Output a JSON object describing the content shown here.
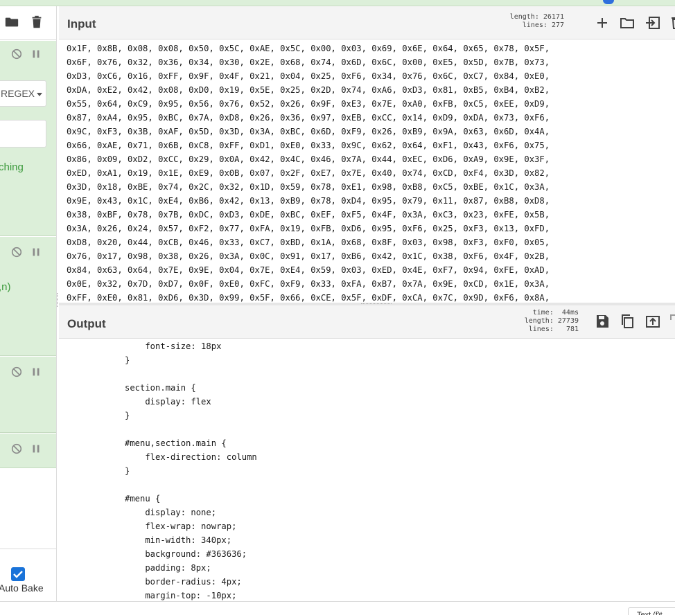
{
  "colors": {
    "operation_bg": "#dcefd9",
    "accent_blue": "#1a73d9",
    "regex_text_green": "#3c9a3c",
    "pane_header_bg": "#f4f4f4"
  },
  "recipe": {
    "toolbar_icons": [
      "folder-icon",
      "trash-icon"
    ],
    "operations": [
      {
        "controls": [
          "disable-icon",
          "pause-icon"
        ],
        "regex_button": "REGEX",
        "text": "ching"
      },
      {
        "controls": [
          "disable-icon",
          "pause-icon"
        ],
        "text": ",n)"
      },
      {
        "controls": [
          "disable-icon",
          "pause-icon"
        ]
      },
      {
        "controls": [
          "disable-icon",
          "pause-icon"
        ]
      }
    ],
    "auto_bake": {
      "label": "Auto Bake",
      "checked": true
    }
  },
  "input": {
    "title": "Input",
    "stats": {
      "length_label": "length:",
      "length": "26171",
      "lines_label": "lines:",
      "lines": "277"
    },
    "icons": [
      "add-tab-icon",
      "open-folder-icon",
      "import-icon",
      "delete-icon"
    ],
    "lines": [
      "0x1F, 0x8B, 0x08, 0x08, 0x50, 0x5C, 0xAE, 0x5C, 0x00, 0x03, 0x69, 0x6E, 0x64, 0x65, 0x78, 0x5F,",
      "0x6F, 0x76, 0x32, 0x36, 0x34, 0x30, 0x2E, 0x68, 0x74, 0x6D, 0x6C, 0x00, 0xE5, 0x5D, 0x7B, 0x73,",
      "0xD3, 0xC6, 0x16, 0xFF, 0x9F, 0x4F, 0x21, 0x04, 0x25, 0xF6, 0x34, 0x76, 0x6C, 0xC7, 0x84, 0xE0,",
      "0xDA, 0xE2, 0x42, 0x08, 0xD0, 0x19, 0x5E, 0x25, 0x2D, 0x74, 0xA6, 0xD3, 0x81, 0xB5, 0xB4, 0xB2,",
      "0x55, 0x64, 0xC9, 0x95, 0x56, 0x76, 0x52, 0x26, 0x9F, 0xE3, 0x7E, 0xA0, 0xFB, 0xC5, 0xEE, 0xD9,",
      "0x87, 0xA4, 0x95, 0xBC, 0x7A, 0xD8, 0x26, 0x36, 0x97, 0xEB, 0xCC, 0x14, 0xD9, 0xDA, 0x73, 0xF6,",
      "0x9C, 0xF3, 0x3B, 0xAF, 0x5D, 0x3D, 0x3A, 0xBC, 0x6D, 0xF9, 0x26, 0xB9, 0x9A, 0x63, 0x6D, 0x4A,",
      "0x66, 0xAE, 0x71, 0x6B, 0xC8, 0xFF, 0xD1, 0xE0, 0x33, 0x9C, 0x62, 0x64, 0xF1, 0x43, 0xF6, 0x75,",
      "0x86, 0x09, 0xD2, 0xCC, 0x29, 0x0A, 0x42, 0x4C, 0x46, 0x7A, 0x44, 0xEC, 0xD6, 0xA9, 0x9E, 0x3F,",
      "0xED, 0xA1, 0x19, 0x1E, 0xE9, 0x0B, 0x07, 0x2F, 0xE7, 0x7E, 0x40, 0x74, 0xCD, 0xF4, 0x3D, 0x82,",
      "0x3D, 0x18, 0xBE, 0x74, 0x2C, 0x32, 0x1D, 0x59, 0x78, 0xE1, 0x98, 0xB8, 0xC5, 0xBE, 0x1C, 0x3A,",
      "0x9E, 0x43, 0x1C, 0xE4, 0xB6, 0x42, 0x13, 0xB9, 0x78, 0xD4, 0x95, 0x79, 0x11, 0x87, 0xB8, 0xD8,",
      "0x38, 0xBF, 0x78, 0x7B, 0xDC, 0xD3, 0xDE, 0xBC, 0xEF, 0xF5, 0x4F, 0x3A, 0xC3, 0x23, 0xFE, 0x5B,",
      "0x3A, 0x26, 0x24, 0x57, 0xF2, 0x77, 0xFA, 0x19, 0xFB, 0xD6, 0x95, 0xF6, 0x25, 0xF3, 0x13, 0xFD,",
      "0xD8, 0x20, 0x44, 0xCB, 0x46, 0x33, 0xC7, 0xBD, 0x1A, 0x68, 0x8F, 0x03, 0x98, 0xF3, 0xF0, 0x05,",
      "0x76, 0x17, 0x98, 0x38, 0x26, 0x3A, 0x0C, 0x91, 0x17, 0xB6, 0x42, 0x1C, 0x38, 0xF6, 0x4F, 0x2B,",
      "0x84, 0x63, 0x64, 0x7E, 0x9E, 0x04, 0x7E, 0xE4, 0x59, 0x03, 0xED, 0x4E, 0xF7, 0x94, 0xFE, 0xAD,",
      "0x0E, 0x32, 0x7D, 0xD7, 0x0F, 0xE0, 0xFC, 0xF9, 0x33, 0xFA, 0xB7, 0x7A, 0x9E, 0xCD, 0x1E, 0x3A,",
      "0xFF, 0xE0, 0x81, 0xD6, 0x3D, 0x99, 0x5F, 0x66, 0xCE, 0x5F, 0xDF, 0xCA, 0x7C, 0x9D, 0xF6, 0x8A,"
    ]
  },
  "output": {
    "title": "Output",
    "stats": {
      "time_label": "time:",
      "time": "44ms",
      "length_label": "length:",
      "length": "27739",
      "lines_label": "lines:",
      "lines": "781"
    },
    "icons": [
      "save-icon",
      "copy-icon",
      "replace-input-icon",
      "maximise-icon"
    ],
    "lines": [
      "    font-size: 18px",
      "}",
      "",
      "section.main {",
      "    display: flex",
      "}",
      "",
      "#menu,section.main {",
      "    flex-direction: column",
      "}",
      "",
      "#menu {",
      "    display: none;",
      "    flex-wrap: nowrap;",
      "    min-width: 340px;",
      "    background: #363636;",
      "    padding: 8px;",
      "    border-radius: 4px;",
      "    margin-top: -10px;"
    ]
  },
  "status": {
    "tab_label": "Text (f)t"
  }
}
